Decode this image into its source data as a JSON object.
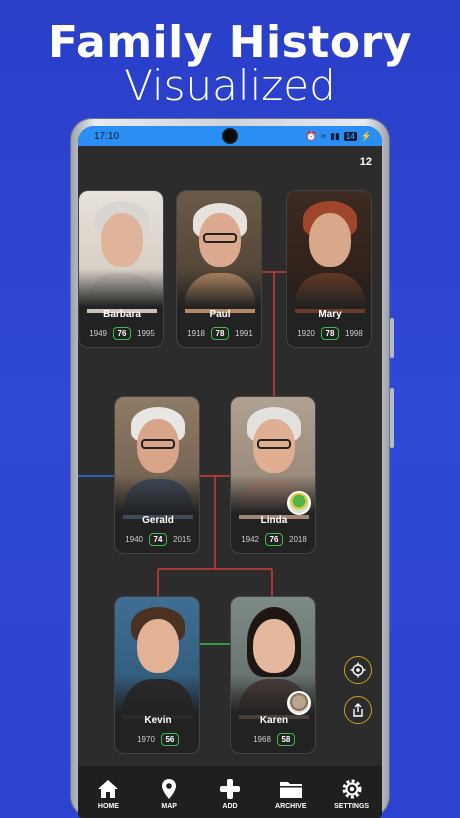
{
  "headline": {
    "line1": "Family History",
    "line2": "Visualized"
  },
  "status_bar": {
    "time": "17:10",
    "battery": "14"
  },
  "tree": {
    "count": "12",
    "people": [
      {
        "name": "Barbara",
        "born": "1949",
        "age": "76",
        "died": "1995"
      },
      {
        "name": "Paul",
        "born": "1918",
        "age": "78",
        "died": "1991"
      },
      {
        "name": "Mary",
        "born": "1920",
        "age": "78",
        "died": "1998"
      },
      {
        "name": "Gerald",
        "born": "1940",
        "age": "74",
        "died": "2015"
      },
      {
        "name": "Linda",
        "born": "1942",
        "age": "76",
        "died": "2018"
      },
      {
        "name": "Kevin",
        "born": "1970",
        "age": "56",
        "died": ""
      },
      {
        "name": "Karen",
        "born": "1968",
        "age": "58",
        "died": ""
      }
    ]
  },
  "nav": {
    "items": [
      {
        "label": "HOME",
        "icon": "home-icon"
      },
      {
        "label": "MAP",
        "icon": "map-pin-icon"
      },
      {
        "label": "ADD",
        "icon": "plus-icon"
      },
      {
        "label": "ARCHIVE",
        "icon": "folder-icon"
      },
      {
        "label": "SETTINGS",
        "icon": "gear-icon"
      }
    ]
  },
  "colors": {
    "background": "#2f48d6",
    "status_bar": "#2a8ef2",
    "line_red": "#d23a3a",
    "line_blue": "#2f6fe0",
    "line_green": "#3bbd4a",
    "age_border": "#3bbd4a",
    "fab_border": "#c8a020"
  }
}
